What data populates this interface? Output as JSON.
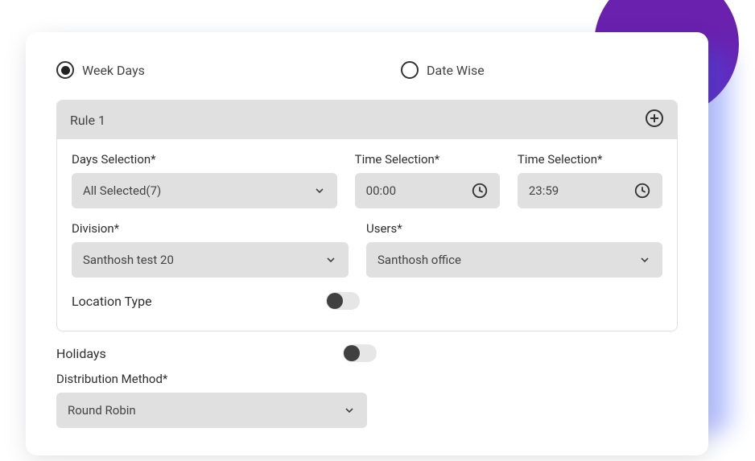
{
  "radios": {
    "weekdays": {
      "label": "Week Days",
      "selected": true
    },
    "datewise": {
      "label": "Date Wise",
      "selected": false
    }
  },
  "rule": {
    "title": "Rule 1",
    "days_label": "Days Selection*",
    "days_value": "All Selected(7)",
    "time_from_label": "Time Selection*",
    "time_from_value": "00:00",
    "time_to_label": "Time Selection*",
    "time_to_value": "23:59",
    "division_label": "Division*",
    "division_value": "Santhosh test 20",
    "users_label": "Users*",
    "users_value": "Santhosh office",
    "location_type_label": "Location Type"
  },
  "footer": {
    "holidays_label": "Holidays",
    "distribution_label": "Distribution Method*",
    "distribution_value": "Round Robin"
  }
}
